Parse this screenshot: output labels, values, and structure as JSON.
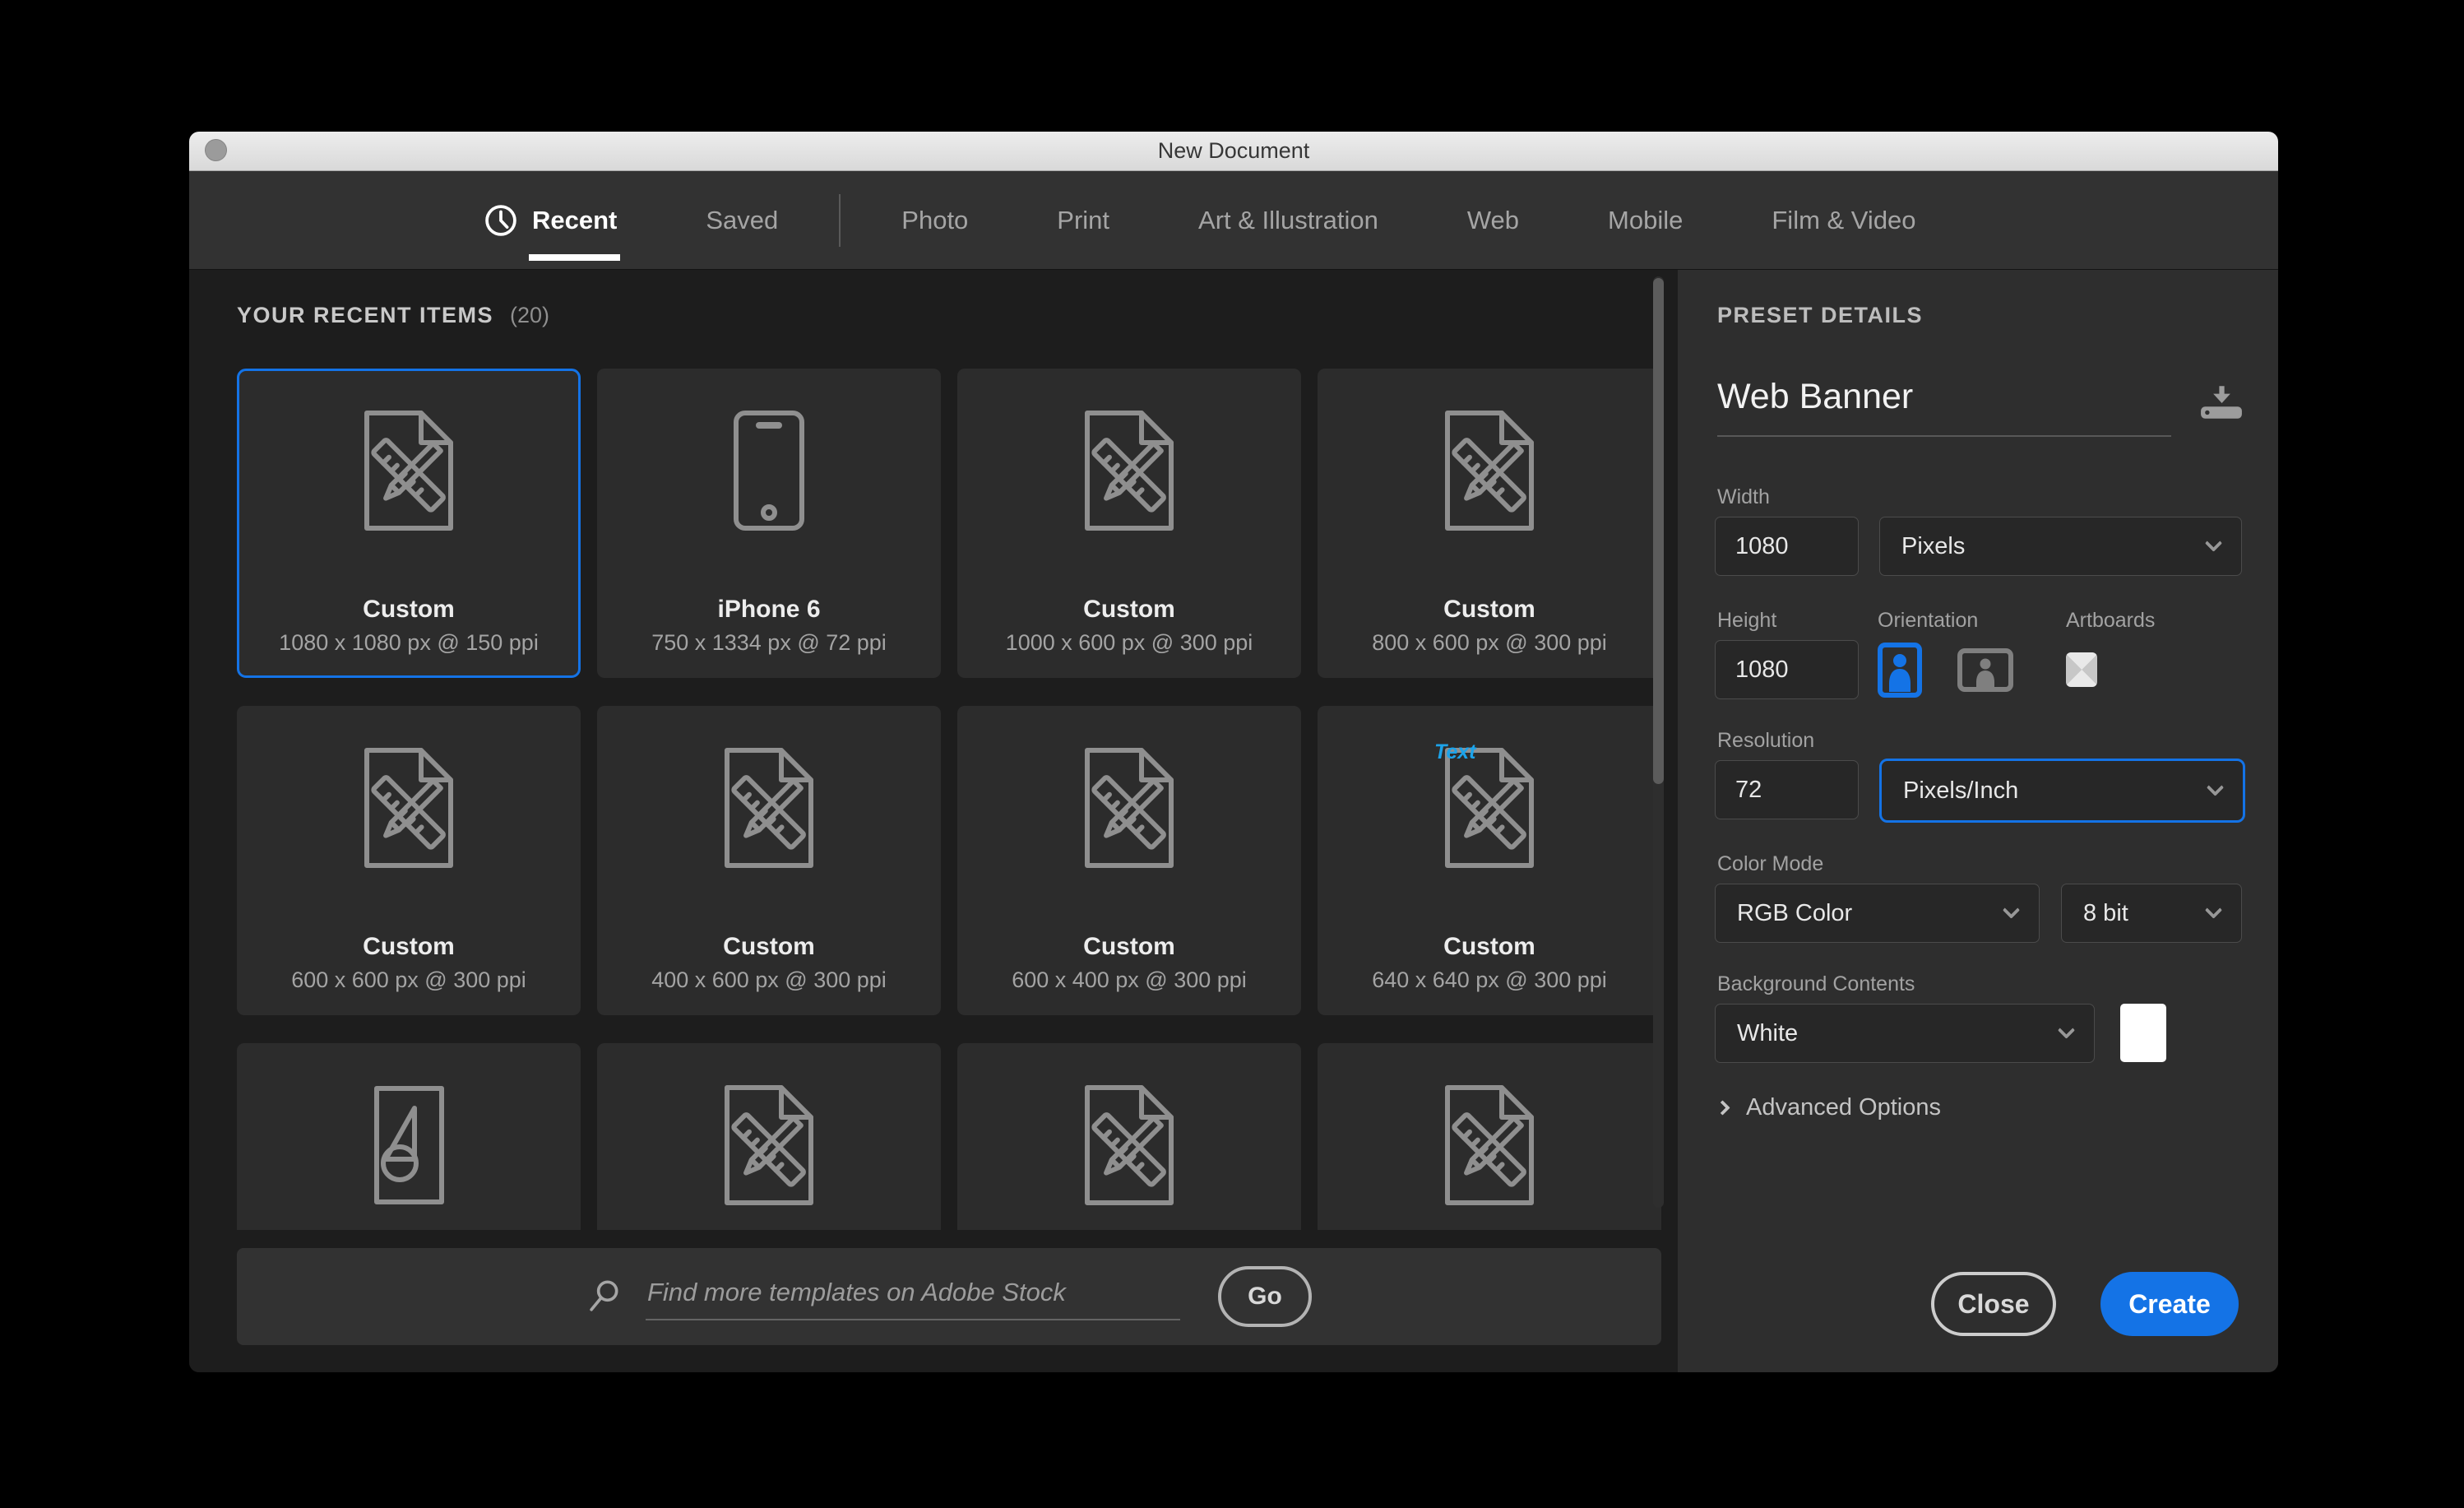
{
  "window": {
    "title": "New Document"
  },
  "tabs": [
    {
      "label": "Recent",
      "active": true
    },
    {
      "label": "Saved"
    },
    {
      "divider": true
    },
    {
      "label": "Photo"
    },
    {
      "label": "Print"
    },
    {
      "label": "Art & Illustration"
    },
    {
      "label": "Web"
    },
    {
      "label": "Mobile"
    },
    {
      "label": "Film & Video"
    }
  ],
  "recent": {
    "heading": "YOUR RECENT ITEMS",
    "count": "(20)",
    "items": [
      {
        "name": "Custom",
        "spec": "1080 x 1080 px @ 150 ppi",
        "icon": "document-ruler-icon",
        "selected": true
      },
      {
        "name": "iPhone 6",
        "spec": "750 x 1334 px @ 72 ppi",
        "icon": "phone-icon"
      },
      {
        "name": "Custom",
        "spec": "1000 x 600 px @ 300 ppi",
        "icon": "document-ruler-icon"
      },
      {
        "name": "Custom",
        "spec": "800 x 600 px @ 300 ppi",
        "icon": "document-ruler-icon"
      },
      {
        "name": "Custom",
        "spec": "600 x 600 px @ 300 ppi",
        "icon": "document-ruler-icon"
      },
      {
        "name": "Custom",
        "spec": "400 x 600 px @ 300 ppi",
        "icon": "document-ruler-icon"
      },
      {
        "name": "Custom",
        "spec": "600 x 400 px @ 300 ppi",
        "icon": "document-ruler-icon"
      },
      {
        "name": "Custom",
        "spec": "640 x 640 px @ 300 ppi",
        "icon": "document-ruler-icon",
        "overlay": "Text"
      },
      {
        "name": "",
        "spec": "",
        "icon": "shapes-icon"
      },
      {
        "name": "",
        "spec": "",
        "icon": "document-ruler-icon"
      },
      {
        "name": "",
        "spec": "",
        "icon": "document-ruler-icon"
      },
      {
        "name": "",
        "spec": "",
        "icon": "document-ruler-icon"
      }
    ]
  },
  "search": {
    "placeholder": "Find more templates on Adobe Stock",
    "go_label": "Go"
  },
  "preset": {
    "heading": "PRESET DETAILS",
    "name_value": "Web Banner",
    "width_label": "Width",
    "width_value": "1080",
    "unit_value": "Pixels",
    "height_label": "Height",
    "height_value": "1080",
    "orientation_label": "Orientation",
    "artboards_label": "Artboards",
    "resolution_label": "Resolution",
    "resolution_value": "72",
    "resolution_unit_value": "Pixels/Inch",
    "color_mode_label": "Color Mode",
    "color_mode_value": "RGB Color",
    "bit_depth_value": "8 bit",
    "background_label": "Background Contents",
    "background_value": "White",
    "advanced_label": "Advanced Options",
    "close_label": "Close",
    "create_label": "Create"
  },
  "colors": {
    "accent": "#1473e6",
    "selection_border": "#1473e6",
    "overlay_text": "#1ca3ea",
    "background_swatch": "#ffffff"
  }
}
